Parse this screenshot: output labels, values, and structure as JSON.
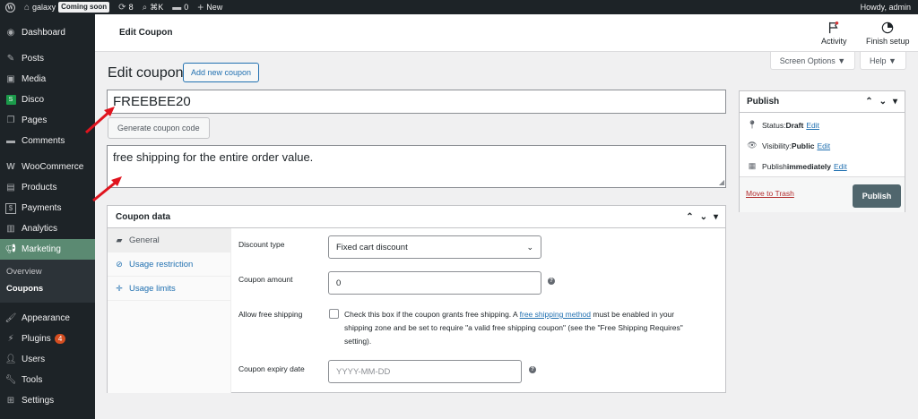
{
  "adminbar": {
    "site_name": "galaxy",
    "coming_soon": "Coming soon",
    "updates": "8",
    "shortcut": "⌘K",
    "comments": "0",
    "new": "New",
    "howdy": "Howdy, admin"
  },
  "sidebar": {
    "items": [
      {
        "label": "Dashboard"
      },
      {
        "label": "Posts"
      },
      {
        "label": "Media"
      },
      {
        "label": "Disco"
      },
      {
        "label": "Pages"
      },
      {
        "label": "Comments"
      },
      {
        "label": "WooCommerce"
      },
      {
        "label": "Products"
      },
      {
        "label": "Payments"
      },
      {
        "label": "Analytics"
      },
      {
        "label": "Marketing"
      },
      {
        "label": "Appearance"
      },
      {
        "label": "Plugins",
        "count": "4"
      },
      {
        "label": "Users"
      },
      {
        "label": "Tools"
      },
      {
        "label": "Settings"
      }
    ],
    "submenu": [
      {
        "label": "Overview"
      },
      {
        "label": "Coupons"
      }
    ]
  },
  "header": {
    "title": "Edit Coupon",
    "activity": "Activity",
    "finish_setup": "Finish setup",
    "screen_options": "Screen Options ▼",
    "help": "Help ▼"
  },
  "main": {
    "heading": "Edit coupon",
    "add_new": "Add new coupon",
    "coupon_code": "FREEBEE20",
    "generate": "Generate coupon code",
    "description": "free shipping for the entire order value."
  },
  "coupon_data": {
    "title": "Coupon data",
    "tabs": [
      {
        "label": "General"
      },
      {
        "label": "Usage restriction"
      },
      {
        "label": "Usage limits"
      }
    ],
    "discount_type_label": "Discount type",
    "discount_type_value": "Fixed cart discount",
    "amount_label": "Coupon amount",
    "amount_value": "0",
    "free_shipping_label": "Allow free shipping",
    "free_shipping_text_1": "Check this box if the coupon grants free shipping. A ",
    "free_shipping_link": "free shipping method",
    "free_shipping_text_2": " must be enabled in your shipping zone and be set to require \"a valid free shipping coupon\" (see the \"Free Shipping Requires\" setting).",
    "expiry_label": "Coupon expiry date",
    "expiry_placeholder": "YYYY-MM-DD"
  },
  "publish": {
    "title": "Publish",
    "status_label": "Status: ",
    "status_value": "Draft",
    "visibility_label": "Visibility: ",
    "visibility_value": "Public",
    "publish_label": "Publish ",
    "publish_value": "immediately",
    "edit": "Edit",
    "trash": "Move to Trash",
    "button": "Publish"
  }
}
